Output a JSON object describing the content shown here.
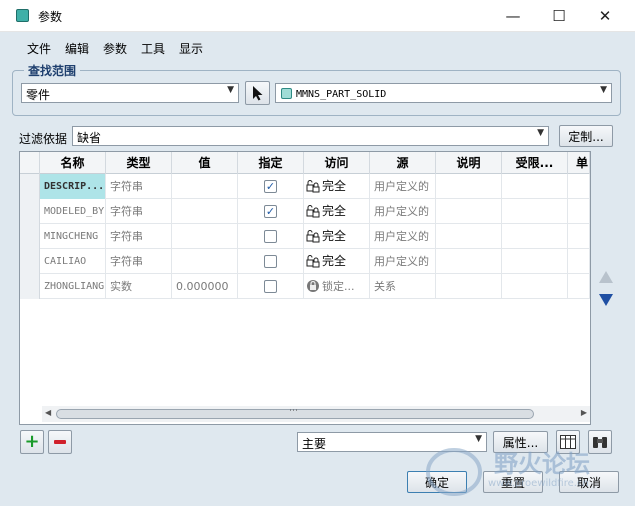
{
  "window": {
    "title": "参数"
  },
  "menu": [
    "文件",
    "编辑",
    "参数",
    "工具",
    "显示"
  ],
  "search_scope": {
    "group_title": "查找范围",
    "type_value": "零件",
    "object_value": "MMNS_PART_SOLID"
  },
  "filter": {
    "label": "过滤依据",
    "value": "缺省",
    "customize_label": "定制..."
  },
  "table": {
    "headers": [
      "名称",
      "类型",
      "值",
      "指定",
      "访问",
      "源",
      "说明",
      "受限...",
      "单"
    ],
    "rows": [
      {
        "name": "DESCRIP...",
        "type": "字符串",
        "value": "",
        "designated": true,
        "access": "完全",
        "source": "用户定义的"
      },
      {
        "name": "MODELED_BY",
        "type": "字符串",
        "value": "",
        "designated": true,
        "access": "完全",
        "source": "用户定义的"
      },
      {
        "name": "MINGCHENG",
        "type": "字符串",
        "value": "",
        "designated": false,
        "access": "完全",
        "source": "用户定义的"
      },
      {
        "name": "CAILIAO",
        "type": "字符串",
        "value": "",
        "designated": false,
        "access": "完全",
        "source": "用户定义的"
      },
      {
        "name": "ZHONGLIANG",
        "type": "实数",
        "value": "0.000000",
        "designated": false,
        "access": "锁定...",
        "source": "关系"
      }
    ]
  },
  "bottom": {
    "main_select": "主要",
    "properties_label": "属性...",
    "ok_label": "确定",
    "reset_label": "重置",
    "cancel_label": "取消"
  },
  "watermark": {
    "text": "野火论坛",
    "url": "www.proewildfire.cn"
  }
}
